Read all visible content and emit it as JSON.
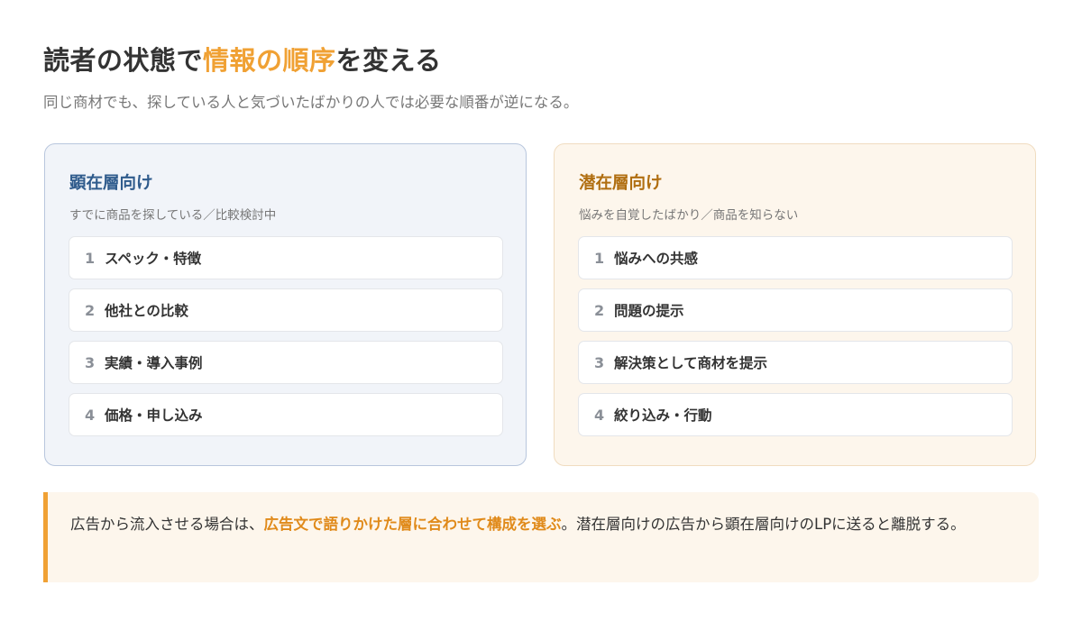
{
  "title": {
    "prefix": "読者の状態で",
    "highlight": "情報の順序",
    "suffix": "を変える"
  },
  "subtitle": "同じ商材でも、探している人と気づいたばかりの人では必要な順番が逆になる。",
  "colors": {
    "accent": "#f0a134",
    "left_title": "#2f5b8c",
    "right_title": "#b06e10",
    "left_bg": "#f1f4f9",
    "right_bg": "#fdf6ec"
  },
  "cards": [
    {
      "title": "顕在層向け",
      "subtitle": "すでに商品を探している／比較検討中",
      "steps": [
        {
          "num": "1",
          "label": "スペック・特徴"
        },
        {
          "num": "2",
          "label": "他社との比較"
        },
        {
          "num": "3",
          "label": "実績・導入事例"
        },
        {
          "num": "4",
          "label": "価格・申し込み"
        }
      ]
    },
    {
      "title": "潜在層向け",
      "subtitle": "悩みを自覚したばかり／商品を知らない",
      "steps": [
        {
          "num": "1",
          "label": "悩みへの共感"
        },
        {
          "num": "2",
          "label": "問題の提示"
        },
        {
          "num": "3",
          "label": "解決策として商材を提示"
        },
        {
          "num": "4",
          "label": "絞り込み・行動"
        }
      ]
    }
  ],
  "callout": {
    "before": "広告から流入させる場合は、",
    "emphasis": "広告文で語りかけた層に合わせて構成を選ぶ",
    "after": "。潜在層向けの広告から顕在層向けのLPに送ると離脱する。"
  }
}
